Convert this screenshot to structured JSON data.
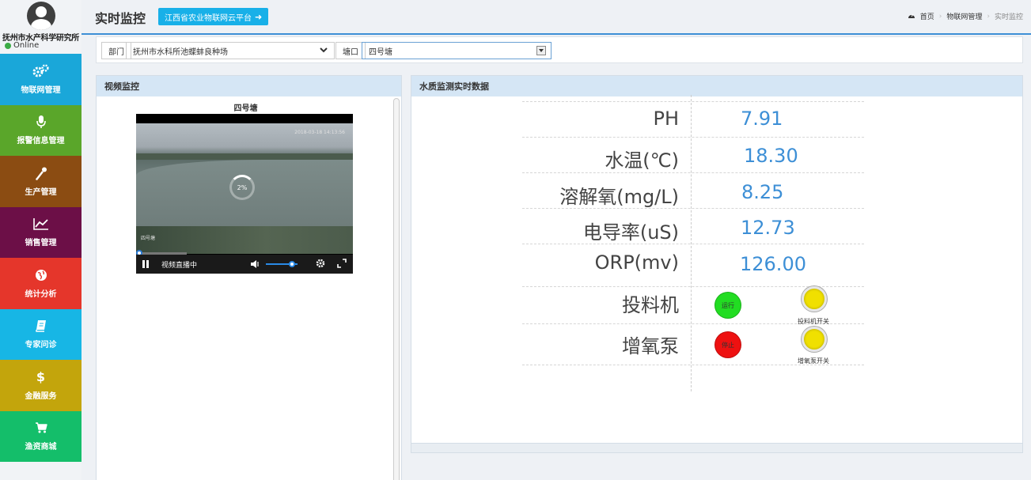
{
  "sidebar": {
    "org_name": "抚州市水产科学研究所",
    "status": "Online",
    "items": [
      {
        "label": "物联网管理",
        "color": "#1aa7d9",
        "icon": "gears-icon"
      },
      {
        "label": "报警信息管理",
        "color": "#5aa62a",
        "icon": "microphone-icon"
      },
      {
        "label": "生产管理",
        "color": "#8b4c12",
        "icon": "eyedropper-icon"
      },
      {
        "label": "销售管理",
        "color": "#6c0f47",
        "icon": "line-chart-icon"
      },
      {
        "label": "统计分析",
        "color": "#e5362b",
        "icon": "globe-icon"
      },
      {
        "label": "专家问诊",
        "color": "#17b6e5",
        "icon": "book-icon"
      },
      {
        "label": "金融服务",
        "color": "#c3a50c",
        "icon": "dollar-icon"
      },
      {
        "label": "渔资商城",
        "color": "#14be6a",
        "icon": "cart-icon"
      }
    ]
  },
  "header": {
    "title": "实时监控",
    "platform_button": "江西省农业物联网云平台",
    "breadcrumb": {
      "home": "首页",
      "level1": "物联网管理",
      "current": "实时监控"
    }
  },
  "filters": {
    "dept_label": "部门",
    "dept_value": "抚州市水科所池蝶蚌良种场",
    "pond_label": "塘口",
    "pond_value": "四号塘"
  },
  "video": {
    "panel_title": "视频监控",
    "title": "四号塘",
    "loading": "2%",
    "timestamp": "2018-03-18 14:13:56",
    "camera_label": "四号塘",
    "live_text": "视频直播中"
  },
  "water": {
    "panel_title": "水质监测实时数据",
    "metrics": [
      {
        "label": "PH",
        "value": "7.91"
      },
      {
        "label": "水温(℃)",
        "value": "18.30"
      },
      {
        "label": "溶解氧(mg/L)",
        "value": "8.25"
      },
      {
        "label": "电导率(uS)",
        "value": "12.73"
      },
      {
        "label": "ORP(mv)",
        "value": "126.00"
      }
    ],
    "devices": [
      {
        "label": "投料机",
        "status": "运行",
        "status_color": "#22dd22",
        "switch_label": "投料机开关"
      },
      {
        "label": "增氧泵",
        "status": "停止",
        "status_color": "#ee1111",
        "switch_label": "增氧泵开关"
      }
    ]
  }
}
